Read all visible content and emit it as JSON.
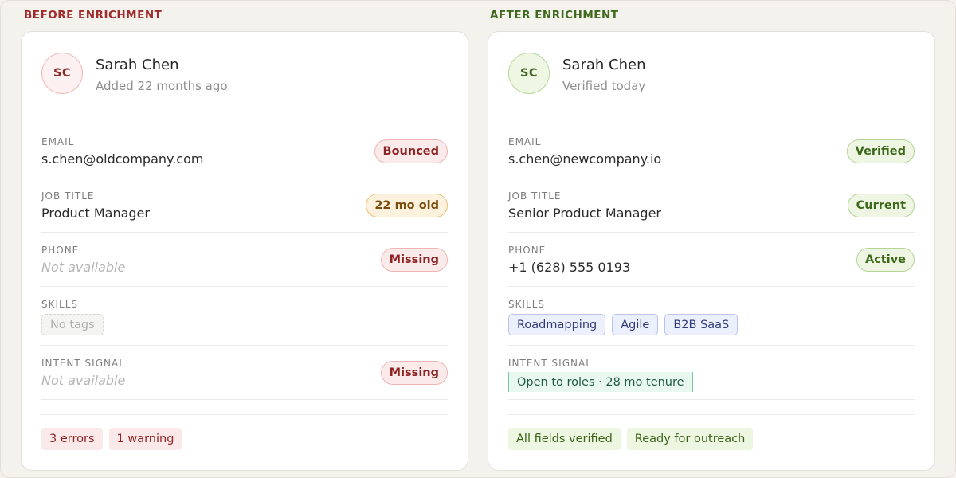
{
  "before": {
    "section_label": "BEFORE ENRICHMENT",
    "avatar_initials": "SC",
    "name": "Sarah Chen",
    "subtitle": "Added 22 months ago",
    "email": {
      "label": "EMAIL",
      "value": "s.chen@oldcompany.com",
      "badge": "Bounced"
    },
    "job_title": {
      "label": "JOB TITLE",
      "value": "Product Manager",
      "badge": "22 mo old"
    },
    "phone": {
      "label": "PHONE",
      "value": "Not available",
      "badge": "Missing"
    },
    "skills": {
      "label": "SKILLS",
      "empty_tag": "No tags"
    },
    "intent": {
      "label": "INTENT SIGNAL",
      "value": "Not available",
      "badge": "Missing"
    },
    "footer": {
      "errors": "3 errors",
      "warnings": "1 warning"
    }
  },
  "after": {
    "section_label": "AFTER ENRICHMENT",
    "avatar_initials": "SC",
    "name": "Sarah Chen",
    "subtitle": "Verified today",
    "email": {
      "label": "EMAIL",
      "value": "s.chen@newcompany.io",
      "badge": "Verified"
    },
    "job_title": {
      "label": "JOB TITLE",
      "value": "Senior Product Manager",
      "badge": "Current"
    },
    "phone": {
      "label": "PHONE",
      "value": "+1 (628) 555 0193",
      "badge": "Active"
    },
    "skills": {
      "label": "SKILLS",
      "tags": [
        "Roadmapping",
        "Agile",
        "B2B SaaS"
      ]
    },
    "intent": {
      "label": "INTENT SIGNAL",
      "tag": "Open to roles · 28 mo tenure"
    },
    "footer": {
      "verified": "All fields verified",
      "ready": "Ready for outreach"
    }
  },
  "colors": {
    "error_red": "#8f2323",
    "warning_amber": "#7a4c0b",
    "success_green": "#3d6a1a",
    "skill_indigo": "#2f3a7a",
    "intent_teal": "#1f5a45"
  }
}
